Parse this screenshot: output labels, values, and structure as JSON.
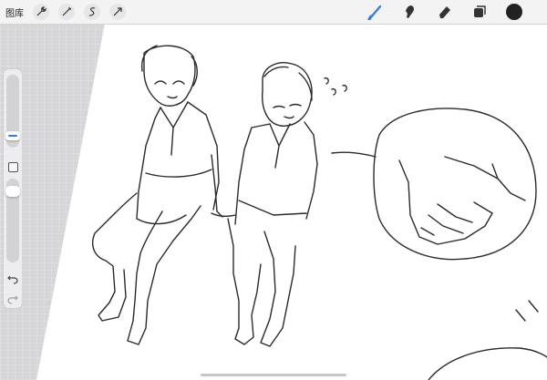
{
  "toolbar": {
    "gallery_label": "图库",
    "left_tools": [
      {
        "icon": "wrench-icon",
        "name": "actions"
      },
      {
        "icon": "magic-wand-icon",
        "name": "adjustments"
      },
      {
        "icon": "selection-icon",
        "name": "selection"
      },
      {
        "icon": "transform-arrow-icon",
        "name": "transform"
      }
    ],
    "right_tools": [
      {
        "icon": "brush-icon",
        "name": "brush",
        "active": true
      },
      {
        "icon": "smudge-icon",
        "name": "smudge"
      },
      {
        "icon": "eraser-icon",
        "name": "eraser"
      },
      {
        "icon": "layers-icon",
        "name": "layers"
      }
    ],
    "current_color": "#222222",
    "accent_color": "#2f7de1"
  },
  "sidebar": {
    "brush_size_slider_icon": "brush-size-slider",
    "modify_button_icon": "square-icon",
    "opacity_slider_icon": "opacity-slider",
    "undo_icon": "undo-icon",
    "redo_icon": "redo-icon"
  }
}
